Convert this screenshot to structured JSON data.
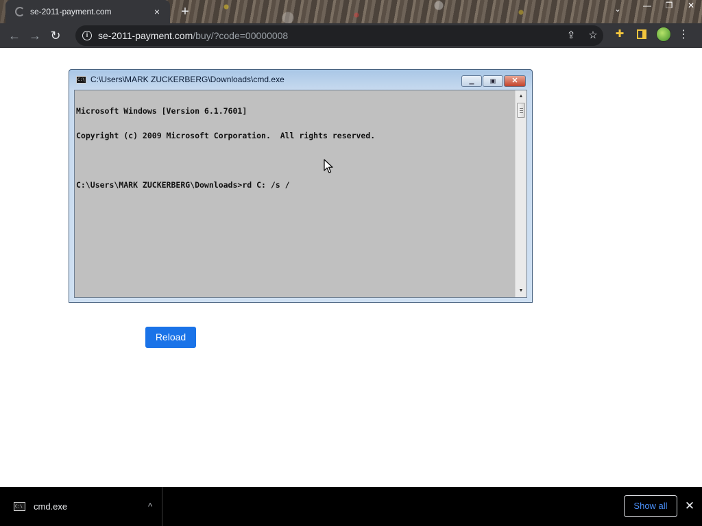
{
  "browser": {
    "tab": {
      "title": "se-2011-payment.com",
      "close_icon": "×"
    },
    "new_tab_icon": "+",
    "tab_search_icon": "⌄",
    "window_controls": {
      "minimize": "—",
      "restore": "❐",
      "close": "✕"
    },
    "toolbar": {
      "back_icon": "←",
      "forward_icon": "→",
      "reload_icon": "↻",
      "url_host": "se-2011-payment.com",
      "url_path": "/buy/?code=00000008",
      "share_icon": "⇪",
      "bookmark_icon": "☆",
      "extensions_icon": "✚",
      "menu_icon": "⋮"
    }
  },
  "cmd_window": {
    "title": "C:\\Users\\MARK ZUCKERBERG\\Downloads\\cmd.exe",
    "icon_text": "C:\\",
    "buttons": {
      "minimize": "▁",
      "maximize": "▣",
      "close": "✕"
    },
    "lines": [
      "Microsoft Windows [Version 6.1.7601]",
      "Copyright (c) 2009 Microsoft Corporation.  All rights reserved.",
      "",
      "C:\\Users\\MARK ZUCKERBERG\\Downloads>rd C: /s /"
    ],
    "scroll_up": "▲",
    "scroll_down": "▼"
  },
  "page": {
    "reload_button": "Reload"
  },
  "download_bar": {
    "item": {
      "name": "cmd.exe",
      "icon_text": "C:\\",
      "chevron": "^"
    },
    "show_all": "Show all",
    "close_icon": "✕"
  },
  "colors": {
    "chrome_dark": "#35363a",
    "omnibox_bg": "#202124",
    "accent_blue": "#1a73e8",
    "cmd_bg": "#c0c0c0",
    "download_bar_bg": "#000000"
  }
}
